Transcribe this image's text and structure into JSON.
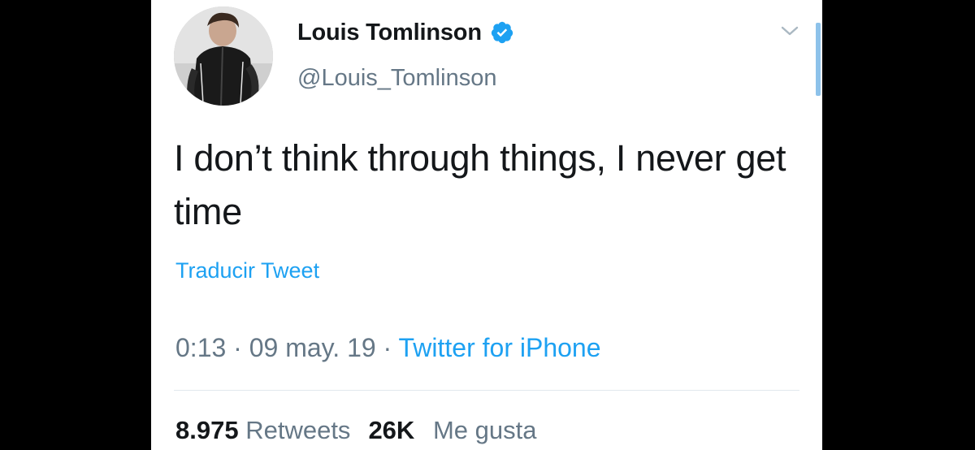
{
  "tweet": {
    "display_name": "Louis Tomlinson",
    "verified": true,
    "handle": "@Louis_Tomlinson",
    "text": "I don’t think through things, I never get time",
    "translate_label": "Traducir Tweet",
    "time": "0:13",
    "separator_1": " · ",
    "date": "09 may. 19",
    "separator_2": " · ",
    "source": "Twitter for iPhone",
    "retweets_count": "8.975",
    "retweets_label": "Retweets",
    "likes_count": "26K",
    "likes_label": "Me gusta"
  },
  "icons": {
    "verified": "verified-badge-icon",
    "caret": "chevron-down-icon"
  },
  "colors": {
    "background": "#000000",
    "card": "#ffffff",
    "primary_text": "#14171a",
    "secondary_text": "#657786",
    "link": "#1da1f2",
    "divider": "#e1e8ed"
  }
}
